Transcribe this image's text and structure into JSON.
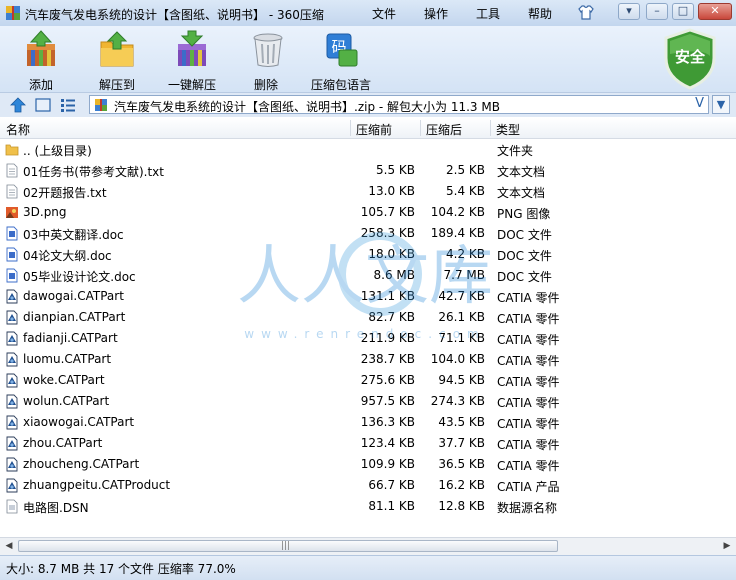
{
  "window": {
    "title": "汽车废气发电系统的设计【含图纸、说明书】 - 360压缩",
    "menu": [
      "文件",
      "操作",
      "工具",
      "帮助"
    ]
  },
  "toolbar": {
    "buttons": [
      {
        "label": "添加",
        "icon": "add-archive-icon"
      },
      {
        "label": "解压到",
        "icon": "extract-to-icon"
      },
      {
        "label": "一键解压",
        "icon": "one-click-extract-icon"
      },
      {
        "label": "删除",
        "icon": "delete-trash-icon"
      },
      {
        "label": "压缩包语言",
        "icon": "archive-language-icon"
      }
    ],
    "security_label": "安全"
  },
  "address": {
    "path": "汽车废气发电系统的设计【含图纸、说明书】.zip - 解包大小为 11.3 MB"
  },
  "columns": [
    "名称",
    "压缩前",
    "压缩后",
    "类型"
  ],
  "files": [
    {
      "name": ".. (上级目录)",
      "size": "",
      "packed": "",
      "type": "文件夹",
      "icon": "folder"
    },
    {
      "name": "01任务书(带参考文献).txt",
      "size": "5.5 KB",
      "packed": "2.5 KB",
      "type": "文本文档",
      "icon": "txt"
    },
    {
      "name": "02开题报告.txt",
      "size": "13.0 KB",
      "packed": "5.4 KB",
      "type": "文本文档",
      "icon": "txt"
    },
    {
      "name": "3D.png",
      "size": "105.7 KB",
      "packed": "104.2 KB",
      "type": "PNG 图像",
      "icon": "png"
    },
    {
      "name": "03中英文翻译.doc",
      "size": "258.3 KB",
      "packed": "189.4 KB",
      "type": "DOC 文件",
      "icon": "doc"
    },
    {
      "name": "04论文大纲.doc",
      "size": "18.0 KB",
      "packed": "4.2 KB",
      "type": "DOC 文件",
      "icon": "doc"
    },
    {
      "name": "05毕业设计论文.doc",
      "size": "8.6 MB",
      "packed": "7.7 MB",
      "type": "DOC 文件",
      "icon": "doc"
    },
    {
      "name": "dawogai.CATPart",
      "size": "131.1 KB",
      "packed": "42.7 KB",
      "type": "CATIA 零件",
      "icon": "cat"
    },
    {
      "name": "dianpian.CATPart",
      "size": "82.7 KB",
      "packed": "26.1 KB",
      "type": "CATIA 零件",
      "icon": "cat"
    },
    {
      "name": "fadianji.CATPart",
      "size": "211.9 KB",
      "packed": "71.1 KB",
      "type": "CATIA 零件",
      "icon": "cat"
    },
    {
      "name": "luomu.CATPart",
      "size": "238.7 KB",
      "packed": "104.0 KB",
      "type": "CATIA 零件",
      "icon": "cat"
    },
    {
      "name": "woke.CATPart",
      "size": "275.6 KB",
      "packed": "94.5 KB",
      "type": "CATIA 零件",
      "icon": "cat"
    },
    {
      "name": "wolun.CATPart",
      "size": "957.5 KB",
      "packed": "274.3 KB",
      "type": "CATIA 零件",
      "icon": "cat"
    },
    {
      "name": "xiaowogai.CATPart",
      "size": "136.3 KB",
      "packed": "43.5 KB",
      "type": "CATIA 零件",
      "icon": "cat"
    },
    {
      "name": "zhou.CATPart",
      "size": "123.4 KB",
      "packed": "37.7 KB",
      "type": "CATIA 零件",
      "icon": "cat"
    },
    {
      "name": "zhoucheng.CATPart",
      "size": "109.9 KB",
      "packed": "36.5 KB",
      "type": "CATIA 零件",
      "icon": "cat"
    },
    {
      "name": "zhuangpeitu.CATProduct",
      "size": "66.7 KB",
      "packed": "16.2 KB",
      "type": "CATIA 产品",
      "icon": "cat"
    },
    {
      "name": "电路图.DSN",
      "size": "81.1 KB",
      "packed": "12.8 KB",
      "type": "数据源名称",
      "icon": "dsn"
    }
  ],
  "watermark": {
    "main": "人人文库",
    "url": "www.renrendoc.com"
  },
  "status": "大小: 8.7 MB 共 17 个文件 压缩率 77.0%"
}
